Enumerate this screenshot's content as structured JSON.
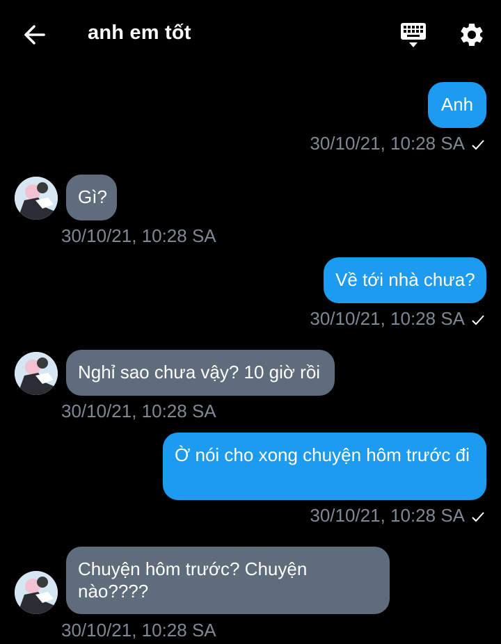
{
  "header": {
    "title": "anh em tốt"
  },
  "messages": [
    {
      "direction": "out",
      "text": "Anh",
      "time": "30/10/21, 10:28 SA"
    },
    {
      "direction": "in",
      "text": "Gì?",
      "time": "30/10/21, 10:28 SA"
    },
    {
      "direction": "out",
      "text": "Về tới nhà chưa?",
      "time": "30/10/21, 10:28 SA"
    },
    {
      "direction": "in",
      "text": "Nghỉ sao chưa vậy? 10 giờ rồi",
      "time": "30/10/21, 10:28 SA"
    },
    {
      "direction": "out",
      "text": "Ờ nói cho xong chuyện hôm trước đi",
      "time": "30/10/21, 10:28 SA"
    },
    {
      "direction": "in",
      "text": "Chuyện hôm trước? Chuyện nào????",
      "time": "30/10/21, 10:28 SA"
    }
  ],
  "colors": {
    "outgoing_bubble": "#1d9bf0",
    "incoming_bubble": "#5f6c7b",
    "timestamp": "#7d8894",
    "background": "#000000"
  },
  "icons": [
    "arrow-left-icon",
    "keyboard-icon",
    "gear-icon",
    "checkmark-icon",
    "avatar"
  ]
}
